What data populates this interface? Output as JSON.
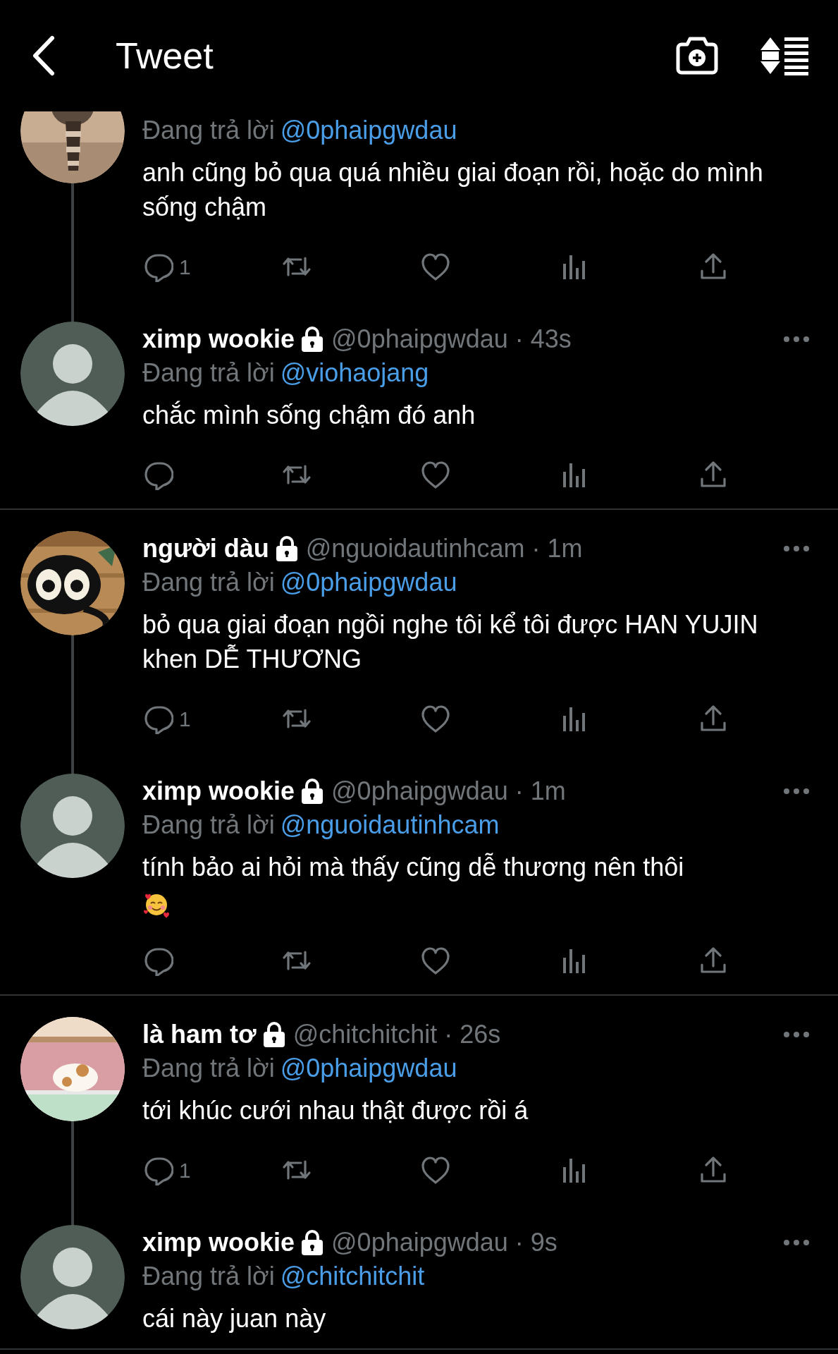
{
  "header": {
    "title": "Tweet"
  },
  "tweets": [
    {
      "replying_label": "Đang trả lời",
      "replying_to": "@0phaipgwdau",
      "text": "anh cũng bỏ qua quá nhiều giai đoạn rồi, hoặc do mình sống chậm",
      "reply_count": "1",
      "thread_line_below": true,
      "divider_below": false
    },
    {
      "avatar": {
        "kind": "person"
      },
      "name": "ximp wookie",
      "protected": true,
      "meta": "@0phaipgwdau · 43s",
      "replying_label": "Đang trả lời",
      "replying_to": "@viohaojang",
      "text": "chắc mình sống chậm đó anh",
      "thread_line_below": false,
      "divider_below": true
    },
    {
      "name": "người dàu",
      "protected": true,
      "meta": "@nguoidautinhcam · 1m",
      "replying_label": "Đang trả lời",
      "replying_to": "@0phaipgwdau",
      "text": "bỏ qua giai đoạn ngồi nghe tôi kể tôi được HAN YUJIN khen DỄ THƯƠNG",
      "reply_count": "1",
      "thread_line_below": true,
      "divider_below": false
    },
    {
      "avatar": {
        "kind": "person"
      },
      "name": "ximp wookie",
      "protected": true,
      "meta": "@0phaipgwdau · 1m",
      "replying_label": "Đang trả lời",
      "replying_to": "@nguoidautinhcam",
      "text": "tính bảo ai hỏi mà thấy cũng dễ thương nên thôi",
      "trailing_emoji": true,
      "thread_line_below": false,
      "divider_below": true
    },
    {
      "name": "là ham tơ",
      "protected": true,
      "meta": "@chitchitchit · 26s",
      "replying_label": "Đang trả lời",
      "replying_to": "@0phaipgwdau",
      "text": "tới khúc cưới nhau thật được rồi á",
      "reply_count": "1",
      "thread_line_below": true,
      "divider_below": false
    },
    {
      "avatar": {
        "kind": "person"
      },
      "name": "ximp wookie",
      "protected": true,
      "meta": "@0phaipgwdau · 9s",
      "replying_label": "Đang trả lời",
      "replying_to": "@chitchitchit",
      "text": "cái này juan này",
      "actions_visible": false,
      "thread_line_below": false,
      "divider_below": true
    }
  ]
}
